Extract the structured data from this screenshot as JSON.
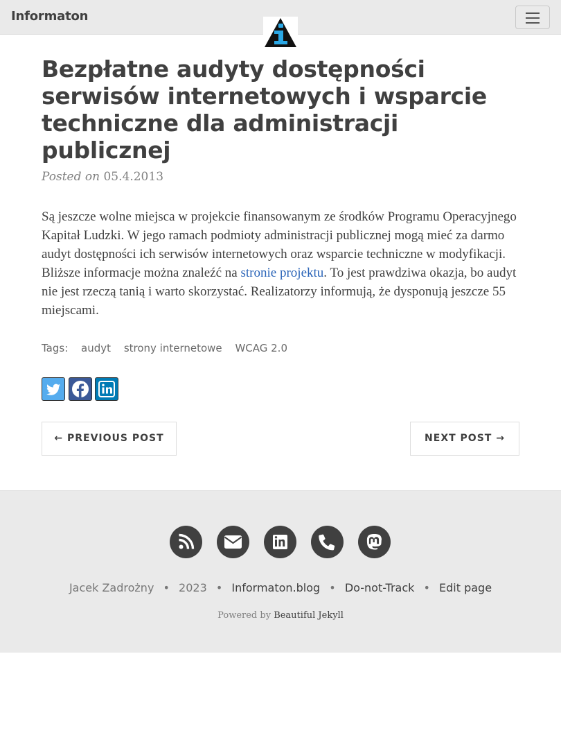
{
  "navbar": {
    "brand": "Informaton",
    "menu_icon": "hamburger-menu-icon",
    "logo_icon": "information-triangle-logo"
  },
  "post": {
    "title": "Bezpłatne audyty dostępności serwisów internetowych i wsparcie techniczne dla administracji publicznej",
    "meta_prefix": "Posted on",
    "date": "05.4.2013",
    "body_part1": "Są jeszcze wolne miejsca w projekcie finansowanym ze środków Programu Operacyjnego Kapitał Ludzki. W jego ramach podmioty administracji publicznej mogą mieć za darmo audyt dostępności ich serwisów internetowych oraz wsparcie techniczne w modyfikacji. Bliższe informacje można znaleźć na ",
    "body_link": "stronie projektu",
    "body_part2": ". To jest prawdziwa okazja, bo audyt nie jest rzeczą tanią i warto skorzystać. Realizatorzy informują, że dysponują jeszcze 55 miejscami.",
    "tags_label": "Tags:",
    "tags": [
      "audyt",
      "strony internetowe",
      "WCAG 2.0"
    ]
  },
  "share": {
    "icons": [
      "twitter-icon",
      "facebook-icon",
      "linkedin-icon"
    ],
    "colors": [
      "#55acee",
      "#3b5998",
      "#007bb5"
    ]
  },
  "pager": {
    "prev": "← PREVIOUS POST",
    "next": "NEXT POST →"
  },
  "footer": {
    "icons": [
      "rss-icon",
      "email-icon",
      "linkedin-icon",
      "phone-icon",
      "mastodon-icon"
    ],
    "author": "Jacek Zadrożny",
    "year": "2023",
    "site": "Informaton.blog",
    "dnt": "Do-not-Track",
    "edit": "Edit page",
    "powered_prefix": "Powered by",
    "powered_link": "Beautiful Jekyll",
    "separator": "•"
  },
  "colors": {
    "navbar_bg": "#eaeaea",
    "text": "#404040",
    "link": "#2a64b8",
    "muted": "#808080"
  }
}
